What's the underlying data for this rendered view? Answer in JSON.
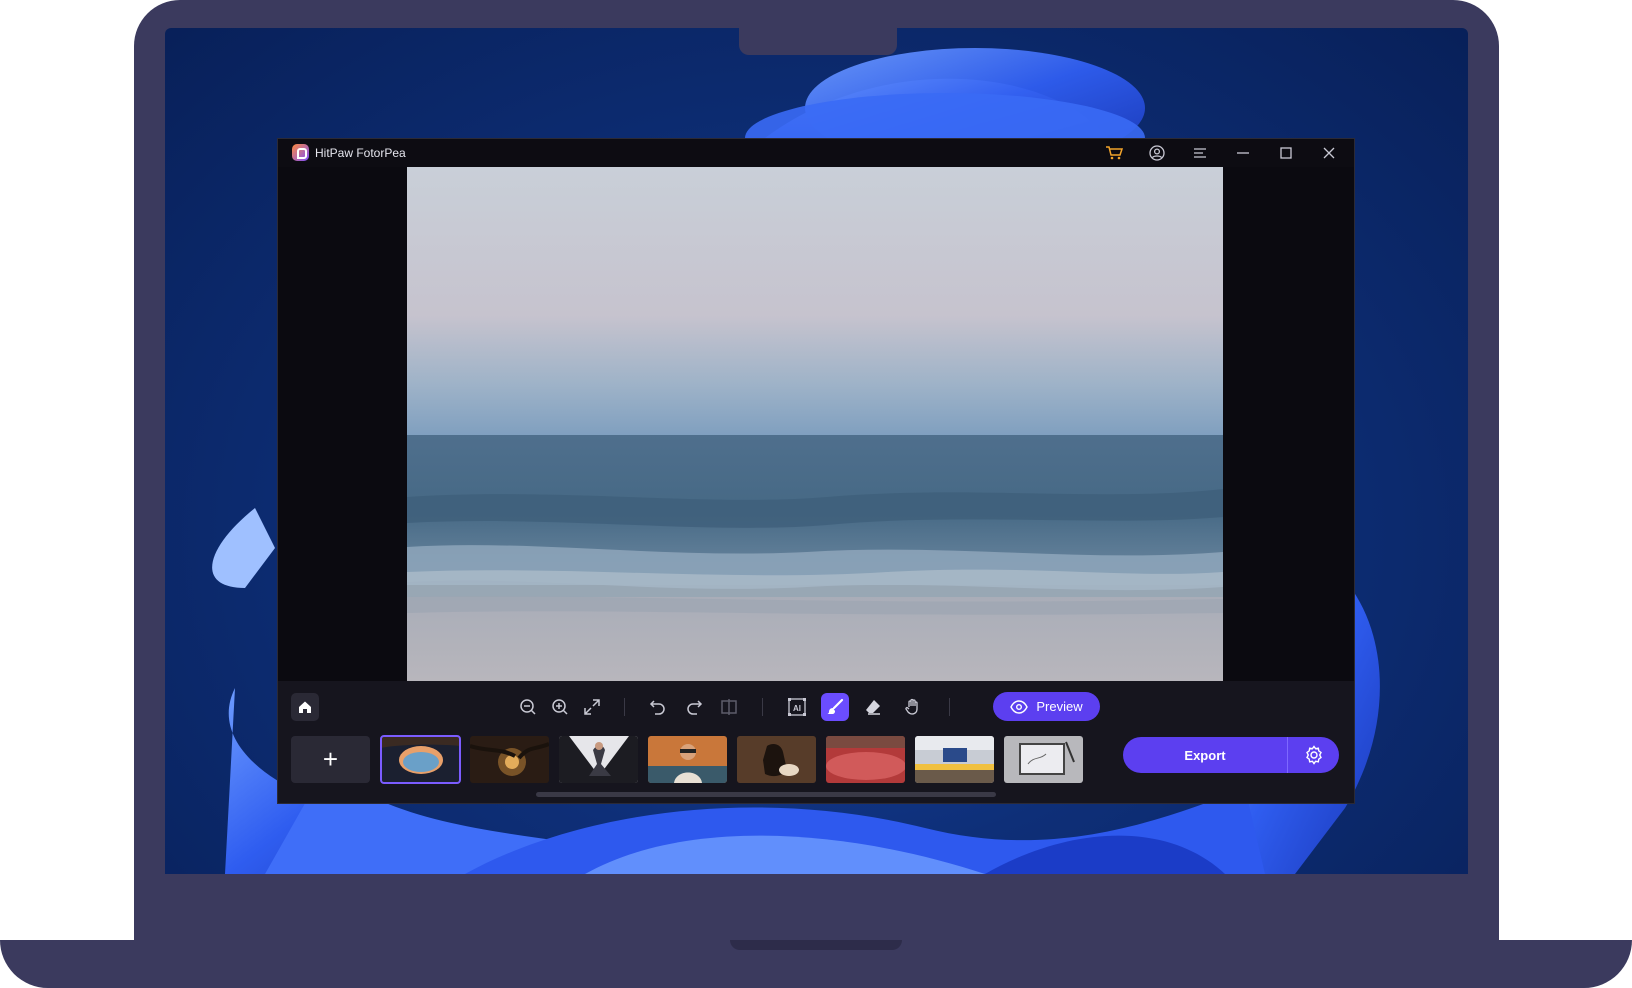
{
  "app": {
    "title": "HitPaw FotorPea"
  },
  "titlebar_icons": [
    "cart-icon",
    "account-icon",
    "menu-icon",
    "minimize-icon",
    "maximize-icon",
    "close-icon"
  ],
  "toolbar": {
    "tools": [
      "home-icon",
      "zoom-out-icon",
      "zoom-in-icon",
      "fit-screen-icon",
      "undo-icon",
      "redo-icon",
      "compare-icon",
      "ai-select-icon",
      "brush-icon",
      "eraser-icon",
      "hand-icon"
    ],
    "active_tool": "brush-icon",
    "preview_label": "Preview"
  },
  "filmstrip": {
    "add_label": "+",
    "selected_index": 0,
    "thumbnails": [
      "sea-cave",
      "sunset-trees",
      "dancer",
      "woman-sunglasses",
      "horse",
      "red-field",
      "desk-workspace",
      "tablet-sketch"
    ]
  },
  "export": {
    "label": "Export"
  },
  "colors": {
    "accent": "#5c3ff0",
    "active_tool": "#6b4dff",
    "chrome": "#3b3a5e"
  }
}
